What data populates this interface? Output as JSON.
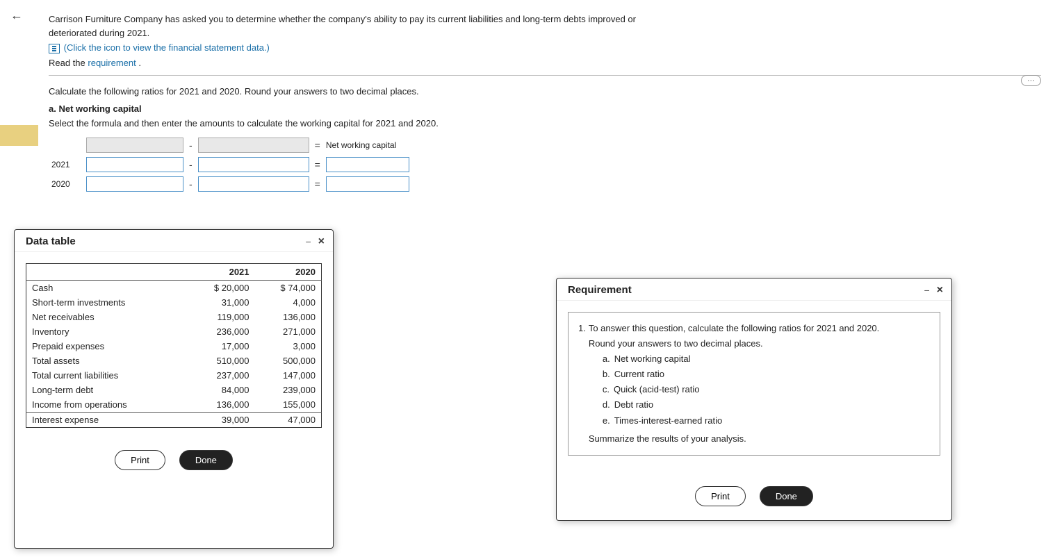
{
  "nav": {
    "back_icon": "←"
  },
  "header": {
    "intro": "Carrison Furniture Company has asked you to determine whether the company's ability to pay its current liabilities and long-term debts improved or deteriorated during 2021.",
    "click_link_text": "(Click the icon to view the financial statement data.)",
    "read_label": "Read the",
    "requirement_link": "requirement",
    "read_period": "."
  },
  "collapse_btn": "···",
  "main": {
    "calculate_text": "Calculate the following ratios for 2021 and 2020. Round your answers to two decimal places.",
    "section_a": "a. Net working capital",
    "formula_instruction": "Select the formula and then enter the amounts to calculate the working capital for 2021 and 2020.",
    "formula_header": {
      "col1": "",
      "col2": "",
      "minus": "-",
      "col3": "",
      "equals": "=",
      "result": "Net working capital"
    },
    "rows": [
      {
        "year": "2021",
        "val1": "",
        "val2": "",
        "result": ""
      },
      {
        "year": "2020",
        "val1": "",
        "val2": "",
        "result": ""
      }
    ]
  },
  "data_table_dialog": {
    "title": "Data table",
    "min_icon": "−",
    "close_icon": "×",
    "table": {
      "headers": [
        "",
        "2021",
        "2020"
      ],
      "rows": [
        [
          "Cash",
          "$ 20,000",
          "$ 74,000"
        ],
        [
          "Short-term investments",
          "31,000",
          "4,000"
        ],
        [
          "Net receivables",
          "119,000",
          "136,000"
        ],
        [
          "Inventory",
          "236,000",
          "271,000"
        ],
        [
          "Prepaid expenses",
          "17,000",
          "3,000"
        ],
        [
          "Total assets",
          "510,000",
          "500,000"
        ],
        [
          "Total current liabilities",
          "237,000",
          "147,000"
        ],
        [
          "Long-term debt",
          "84,000",
          "239,000"
        ],
        [
          "Income from operations",
          "136,000",
          "155,000"
        ],
        [
          "Interest expense",
          "39,000",
          "47,000"
        ]
      ]
    },
    "print_label": "Print",
    "done_label": "Done"
  },
  "requirement_dialog": {
    "title": "Requirement",
    "min_icon": "−",
    "close_icon": "×",
    "content": {
      "item1_prefix": "1.",
      "item1_text": "To answer this question, calculate the following ratios for 2021 and 2020.",
      "item1_text2": "Round your answers to two decimal places.",
      "sub_items": [
        {
          "letter": "a.",
          "text": "Net working capital"
        },
        {
          "letter": "b.",
          "text": "Current ratio"
        },
        {
          "letter": "c.",
          "text": "Quick (acid-test) ratio"
        },
        {
          "letter": "d.",
          "text": "Debt ratio"
        },
        {
          "letter": "e.",
          "text": "Times-interest-earned ratio"
        }
      ],
      "summarize": "Summarize the results of your analysis."
    },
    "print_label": "Print",
    "done_label": "Done"
  }
}
